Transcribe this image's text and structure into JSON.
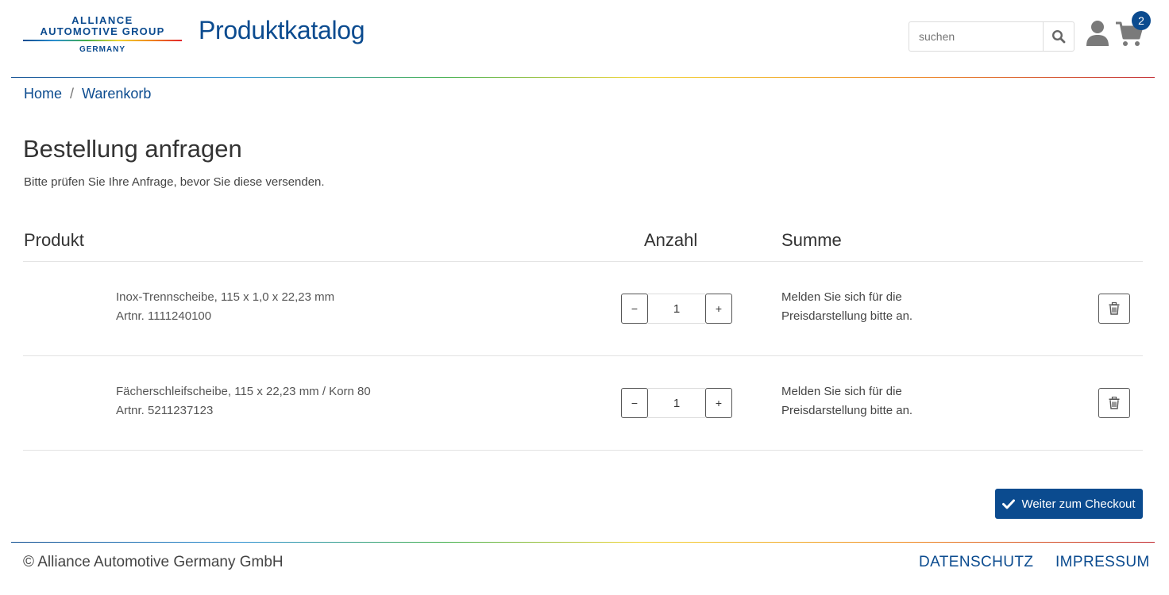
{
  "header": {
    "logo_line1": "ALLIANCE",
    "logo_line2": "AUTOMOTIVE GROUP",
    "logo_line3": "GERMANY",
    "title": "Produktkatalog",
    "search_placeholder": "suchen",
    "cart_count": "2",
    "icons": [
      "search-icon",
      "user-icon",
      "cart-icon"
    ]
  },
  "breadcrumb": {
    "items": [
      "Home",
      "Warenkorb"
    ],
    "separator": "/"
  },
  "main": {
    "title": "Bestellung anfragen",
    "subtitle": "Bitte prüfen Sie Ihre Anfrage, bevor Sie diese versenden."
  },
  "table": {
    "columns": [
      "Produkt",
      "Anzahl",
      "Summe"
    ],
    "rows": [
      {
        "name": "Inox-Trennscheibe, 115 x 1,0 x 22,23 mm",
        "artnr": "Artnr. 1111240100",
        "quantity": "1",
        "minus": "−",
        "plus": "+",
        "price_note_1": "Melden Sie sich für die",
        "price_note_2": "Preisdarstellung bitte an."
      },
      {
        "name": "Fächerschleifscheibe, 115 x 22,23 mm / Korn 80",
        "artnr": "Artnr. 5211237123",
        "quantity": "1",
        "minus": "−",
        "plus": "+",
        "price_note_1": "Melden Sie sich für die",
        "price_note_2": "Preisdarstellung bitte an."
      }
    ]
  },
  "checkout": {
    "label": "Weiter zum Checkout"
  },
  "footer": {
    "copyright": "© Alliance Automotive Germany GmbH",
    "links": [
      "DATENSCHUTZ",
      "IMPRESSUM"
    ]
  },
  "colors": {
    "brand": "#0b4b8f",
    "text": "#333333",
    "border": "#555555"
  }
}
